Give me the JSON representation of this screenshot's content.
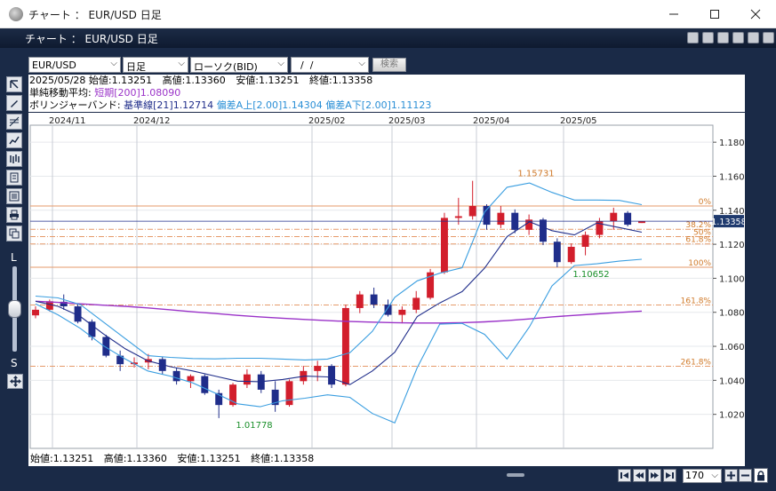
{
  "window": {
    "title": "チャート ： EUR/USD 日足"
  },
  "app": {
    "title": "チャート ： EUR/USD 日足"
  },
  "toolbar": {
    "symbol": "EUR/USD",
    "period": "日足",
    "chart_type": "ローソク(BID)",
    "date": "  /  /",
    "search_label": "検索"
  },
  "left_toolbar": {
    "zoom_large_label": "L",
    "zoom_small_label": "S"
  },
  "info": {
    "date": "2025/05/28",
    "open": "始値:1.13251",
    "high": "高値:1.13360",
    "low": "安値:1.13251",
    "close": "終値:1.13358",
    "sma_label": "単純移動平均:",
    "sma_value": "短期[200]1.08090",
    "boll_label": "ボリンジャーバンド:",
    "boll_mid": "基準線[21]1.12714",
    "boll_upper": "偏差A上[2.00]1.14304",
    "boll_lower": "偏差A下[2.00]1.11123"
  },
  "chart_data": {
    "type": "candlestick",
    "x_labels": [
      "2024/11",
      "2024/12",
      "2025/02",
      "2025/03",
      "2025/04",
      "2025/05"
    ],
    "y_ticks": [
      1.18,
      1.16,
      1.14,
      1.12,
      1.1,
      1.08,
      1.06,
      1.04,
      1.02
    ],
    "y_tick_labels": [
      "1.18000",
      "1.16000",
      "1.14000",
      "1.12000",
      "1.10000",
      "1.08000",
      "1.06000",
      "1.04000",
      "1.02000"
    ],
    "ylim": [
      1.0,
      1.19
    ],
    "current_price_label": "1.13358",
    "current_price": 1.13358,
    "fib_levels": [
      {
        "label": "0%",
        "value": 1.1425,
        "color": "#e69a6a",
        "style": "solid"
      },
      {
        "label": "38.2%",
        "value": 1.1288,
        "color": "#e69a6a",
        "style": "dashdot"
      },
      {
        "label": "50%",
        "value": 1.1245,
        "color": "#e69a6a",
        "style": "dashdot"
      },
      {
        "label": "61.8%",
        "value": 1.1202,
        "color": "#e69a6a",
        "style": "dashdot"
      },
      {
        "label": "100%",
        "value": 1.1065,
        "color": "#e69a6a",
        "style": "solid"
      },
      {
        "label": "161.8%",
        "value": 1.0843,
        "color": "#e69a6a",
        "style": "dashdot"
      },
      {
        "label": "261.8%",
        "value": 1.0483,
        "color": "#e69a6a",
        "style": "dashdot"
      }
    ],
    "annotations": [
      {
        "label": "1.15731",
        "value": 1.15731,
        "color": "#d07a2a"
      },
      {
        "label": "1.10652",
        "value": 1.10652,
        "color": "#1a8f2a"
      },
      {
        "label": "1.01778",
        "value": 1.01778,
        "color": "#1a8f2a"
      }
    ],
    "colors": {
      "up": "#d21e2c",
      "down": "#1f2d8a",
      "sma": "#9a32c8",
      "boll_band": "#3a9ee0",
      "boll_mid": "#1f2d8a"
    },
    "sma_200": [
      1.0865,
      1.0858,
      1.085,
      1.0842,
      1.0835,
      1.0826,
      1.0815,
      1.0803,
      1.0793,
      1.0782,
      1.0773,
      1.0765,
      1.0758,
      1.0751,
      1.0746,
      1.0742,
      1.0739,
      1.0737,
      1.0737,
      1.0739,
      1.0744,
      1.0751,
      1.0761,
      1.0773,
      1.0782,
      1.0791,
      1.0799,
      1.0807
    ],
    "boll_upper": [
      1.0895,
      1.0885,
      1.0845,
      1.0745,
      1.0645,
      1.0545,
      1.0535,
      1.0528,
      1.0526,
      1.053,
      1.053,
      1.0525,
      1.052,
      1.0525,
      1.0562,
      1.0688,
      1.0888,
      1.0985,
      1.103,
      1.1062,
      1.139,
      1.1535,
      1.156,
      1.1505,
      1.146,
      1.146,
      1.1458,
      1.1433
    ],
    "boll_mid": [
      1.0865,
      1.0835,
      1.0775,
      1.0675,
      1.0585,
      1.0515,
      1.048,
      1.0455,
      1.0425,
      1.0395,
      1.0392,
      1.0405,
      1.0425,
      1.042,
      1.0375,
      1.0455,
      1.0565,
      1.0775,
      1.0855,
      1.0922,
      1.106,
      1.1245,
      1.1332,
      1.128,
      1.1255,
      1.1325,
      1.1298,
      1.1271
    ],
    "boll_lower": [
      1.085,
      1.0785,
      1.0705,
      1.0605,
      1.0525,
      1.0455,
      1.0425,
      1.0385,
      1.0325,
      1.0262,
      1.0245,
      1.028,
      1.0295,
      1.0315,
      1.03,
      1.0205,
      1.015,
      1.0475,
      1.073,
      1.0735,
      1.067,
      1.0525,
      1.0715,
      1.0955,
      1.1075,
      1.1085,
      1.1101,
      1.1112
    ],
    "candles": [
      {
        "o": 1.0782,
        "h": 1.0835,
        "l": 1.0765,
        "c": 1.0815
      },
      {
        "o": 1.0815,
        "h": 1.0875,
        "l": 1.0805,
        "c": 1.0865
      },
      {
        "o": 1.0862,
        "h": 1.0905,
        "l": 1.0815,
        "c": 1.0835
      },
      {
        "o": 1.0835,
        "h": 1.085,
        "l": 1.0735,
        "c": 1.0745
      },
      {
        "o": 1.0745,
        "h": 1.0758,
        "l": 1.0635,
        "c": 1.0655
      },
      {
        "o": 1.0655,
        "h": 1.0668,
        "l": 1.0535,
        "c": 1.0545
      },
      {
        "o": 1.0545,
        "h": 1.0575,
        "l": 1.0455,
        "c": 1.0495
      },
      {
        "o": 1.0495,
        "h": 1.0535,
        "l": 1.0475,
        "c": 1.0505
      },
      {
        "o": 1.0505,
        "h": 1.0555,
        "l": 1.0465,
        "c": 1.0525
      },
      {
        "o": 1.0525,
        "h": 1.0538,
        "l": 1.0435,
        "c": 1.0455
      },
      {
        "o": 1.0455,
        "h": 1.0475,
        "l": 1.0375,
        "c": 1.0395
      },
      {
        "o": 1.0395,
        "h": 1.0435,
        "l": 1.0355,
        "c": 1.0425
      },
      {
        "o": 1.0425,
        "h": 1.0435,
        "l": 1.0315,
        "c": 1.0325
      },
      {
        "o": 1.0325,
        "h": 1.0345,
        "l": 1.0178,
        "c": 1.0255
      },
      {
        "o": 1.0255,
        "h": 1.0385,
        "l": 1.0245,
        "c": 1.0375
      },
      {
        "o": 1.0375,
        "h": 1.0465,
        "l": 1.0355,
        "c": 1.0435
      },
      {
        "o": 1.0435,
        "h": 1.0455,
        "l": 1.0325,
        "c": 1.0345
      },
      {
        "o": 1.0345,
        "h": 1.0395,
        "l": 1.0215,
        "c": 1.0255
      },
      {
        "o": 1.0255,
        "h": 1.0405,
        "l": 1.0245,
        "c": 1.0395
      },
      {
        "o": 1.0395,
        "h": 1.0485,
        "l": 1.0375,
        "c": 1.0455
      },
      {
        "o": 1.0455,
        "h": 1.0515,
        "l": 1.0395,
        "c": 1.0485
      },
      {
        "o": 1.0485,
        "h": 1.0495,
        "l": 1.0355,
        "c": 1.0375
      },
      {
        "o": 1.0375,
        "h": 1.0845,
        "l": 1.0365,
        "c": 1.0825
      },
      {
        "o": 1.0825,
        "h": 1.0925,
        "l": 1.0795,
        "c": 1.0905
      },
      {
        "o": 1.0905,
        "h": 1.0945,
        "l": 1.0825,
        "c": 1.0845
      },
      {
        "o": 1.0845,
        "h": 1.0875,
        "l": 1.0775,
        "c": 1.0785
      },
      {
        "o": 1.0785,
        "h": 1.0835,
        "l": 1.0735,
        "c": 1.0815
      },
      {
        "o": 1.0815,
        "h": 1.0925,
        "l": 1.0795,
        "c": 1.0885
      },
      {
        "o": 1.0885,
        "h": 1.1055,
        "l": 1.0875,
        "c": 1.1035
      },
      {
        "o": 1.1035,
        "h": 1.1385,
        "l": 1.1025,
        "c": 1.1355
      },
      {
        "o": 1.1355,
        "h": 1.1473,
        "l": 1.1315,
        "c": 1.1365
      },
      {
        "o": 1.1365,
        "h": 1.1573,
        "l": 1.1345,
        "c": 1.1425
      },
      {
        "o": 1.1425,
        "h": 1.1435,
        "l": 1.1285,
        "c": 1.1315
      },
      {
        "o": 1.1315,
        "h": 1.1425,
        "l": 1.1295,
        "c": 1.1385
      },
      {
        "o": 1.1385,
        "h": 1.1405,
        "l": 1.1265,
        "c": 1.1285
      },
      {
        "o": 1.1285,
        "h": 1.1375,
        "l": 1.1255,
        "c": 1.1345
      },
      {
        "o": 1.1345,
        "h": 1.1355,
        "l": 1.1195,
        "c": 1.1215
      },
      {
        "o": 1.1215,
        "h": 1.1235,
        "l": 1.1065,
        "c": 1.1095
      },
      {
        "o": 1.1095,
        "h": 1.1205,
        "l": 1.1085,
        "c": 1.1185
      },
      {
        "o": 1.1185,
        "h": 1.1275,
        "l": 1.1135,
        "c": 1.1255
      },
      {
        "o": 1.1255,
        "h": 1.1355,
        "l": 1.1235,
        "c": 1.1335
      },
      {
        "o": 1.1335,
        "h": 1.1415,
        "l": 1.1285,
        "c": 1.1385
      },
      {
        "o": 1.1385,
        "h": 1.1395,
        "l": 1.1305,
        "c": 1.1315
      },
      {
        "o": 1.1325,
        "h": 1.1336,
        "l": 1.1325,
        "c": 1.13358
      }
    ]
  },
  "footer": {
    "open": "始値:1.13251",
    "high": "高値:1.13360",
    "low": "安値:1.13251",
    "close": "終値:1.13358",
    "bar_count": "170"
  }
}
